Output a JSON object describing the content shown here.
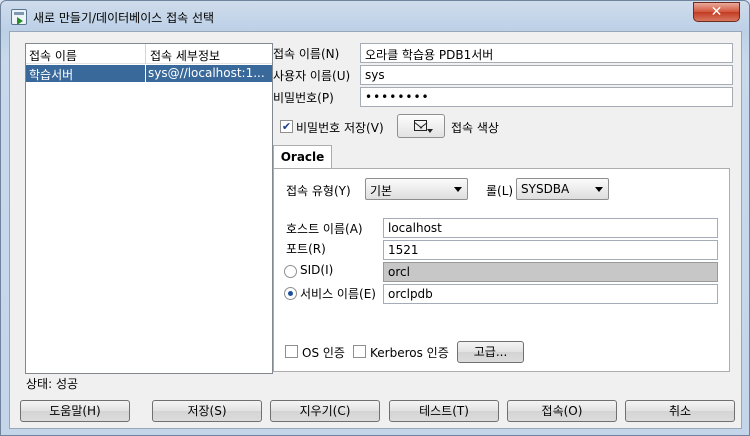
{
  "window": {
    "title": "새로 만들기/데이터베이스 접속 선택",
    "close_label": "✕"
  },
  "conn_list": {
    "headers": [
      "접속 이름",
      "접속 세부정보"
    ],
    "rows": [
      {
        "name": "학습서버",
        "details": "sys@//localhost:1..."
      }
    ]
  },
  "form": {
    "conn_name_label": "접속 이름(N)",
    "conn_name_value": "오라클 학습용 PDB1서버",
    "user_label": "사용자 이름(U)",
    "user_value": "sys",
    "password_label": "비밀번호(P)",
    "password_value": "••••••••",
    "save_password_label": "비밀번호 저장(V)",
    "save_password_checked": true,
    "color_label": "접속 색상",
    "color_icon": "envelope-icon"
  },
  "tab": {
    "label": "Oracle",
    "conn_type_label": "접속 유형(Y)",
    "conn_type_value": "기본",
    "role_label": "롤(L)",
    "role_value": "SYSDBA",
    "host_label": "호스트 이름(A)",
    "host_value": "localhost",
    "port_label": "포트(R)",
    "port_value": "1521",
    "sid_label": "SID(I)",
    "sid_value": "orcl",
    "service_label": "서비스 이름(E)",
    "service_value": "orclpdb",
    "os_auth_label": "OS 인증",
    "kerberos_label": "Kerberos 인증",
    "advanced_label": "고급..."
  },
  "status": {
    "text": "상태: 성공"
  },
  "buttons": {
    "help": "도움말(H)",
    "save": "저장(S)",
    "clear": "지우기(C)",
    "test": "테스트(T)",
    "connect": "접속(O)",
    "cancel": "취소"
  },
  "colors": {
    "selection": "#39699b",
    "close": "#c23b22",
    "title_bg": "#bcd0e6"
  }
}
